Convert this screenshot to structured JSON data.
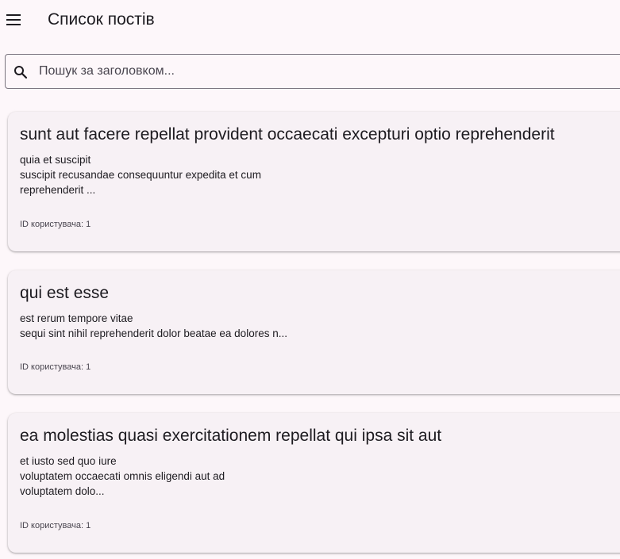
{
  "appbar": {
    "title": "Список постів",
    "menu_icon": "menu-icon"
  },
  "search": {
    "icon": "search-icon",
    "placeholder": "Пошук за заголовком...",
    "value": ""
  },
  "posts": [
    {
      "title": "sunt aut facere repellat provident occaecati excepturi optio reprehenderit",
      "body": "quia et suscipit\nsuscipit recusandae consequuntur expedita et cum\nreprehenderit ...",
      "user_label": "ID користувача: 1"
    },
    {
      "title": "qui est esse",
      "body": "est rerum tempore vitae\nsequi sint nihil reprehenderit dolor beatae ea dolores n...",
      "user_label": "ID користувача: 1"
    },
    {
      "title": "ea molestias quasi exercitationem repellat qui ipsa sit aut",
      "body": "et iusto sed quo iure\nvoluptatem occaecati omnis eligendi aut ad\nvoluptatem dolo...",
      "user_label": "ID користувача: 1"
    }
  ]
}
